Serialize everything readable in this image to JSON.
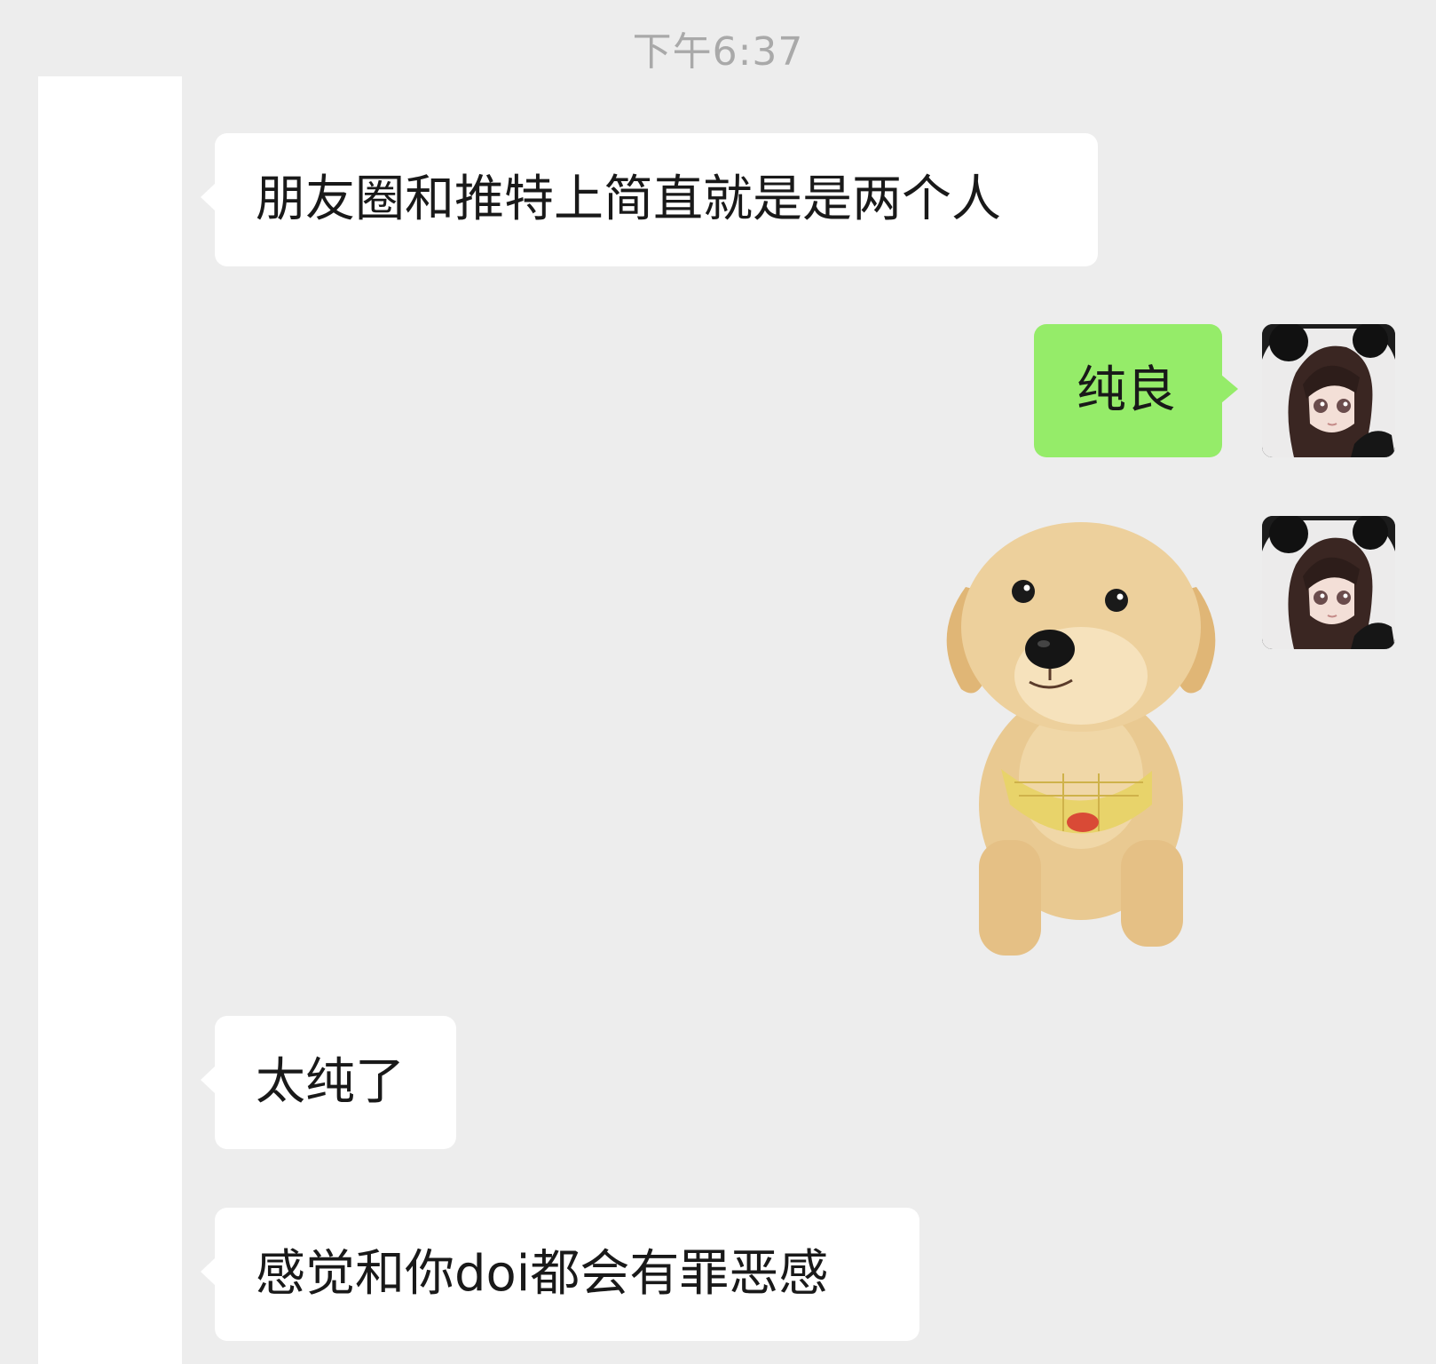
{
  "chat": {
    "timestamp": "下午6:37",
    "messages": [
      {
        "side": "in",
        "text": "朋友圈和推特上简直就是是两个人"
      },
      {
        "side": "out",
        "text": "纯良"
      },
      {
        "side": "out",
        "type": "sticker",
        "sticker": "golden-retriever-puppy"
      },
      {
        "side": "in",
        "text": "太纯了"
      },
      {
        "side": "in",
        "text": "感觉和你doi都会有罪恶感"
      }
    ]
  },
  "colors": {
    "background": "#ededed",
    "incoming_bubble": "#ffffff",
    "outgoing_bubble": "#95ec69",
    "timestamp_text": "#a9a9a9",
    "message_text": "#191919"
  },
  "icons": {
    "avatar": "anime-girl-avatar",
    "sticker": "puppy-sticker"
  }
}
